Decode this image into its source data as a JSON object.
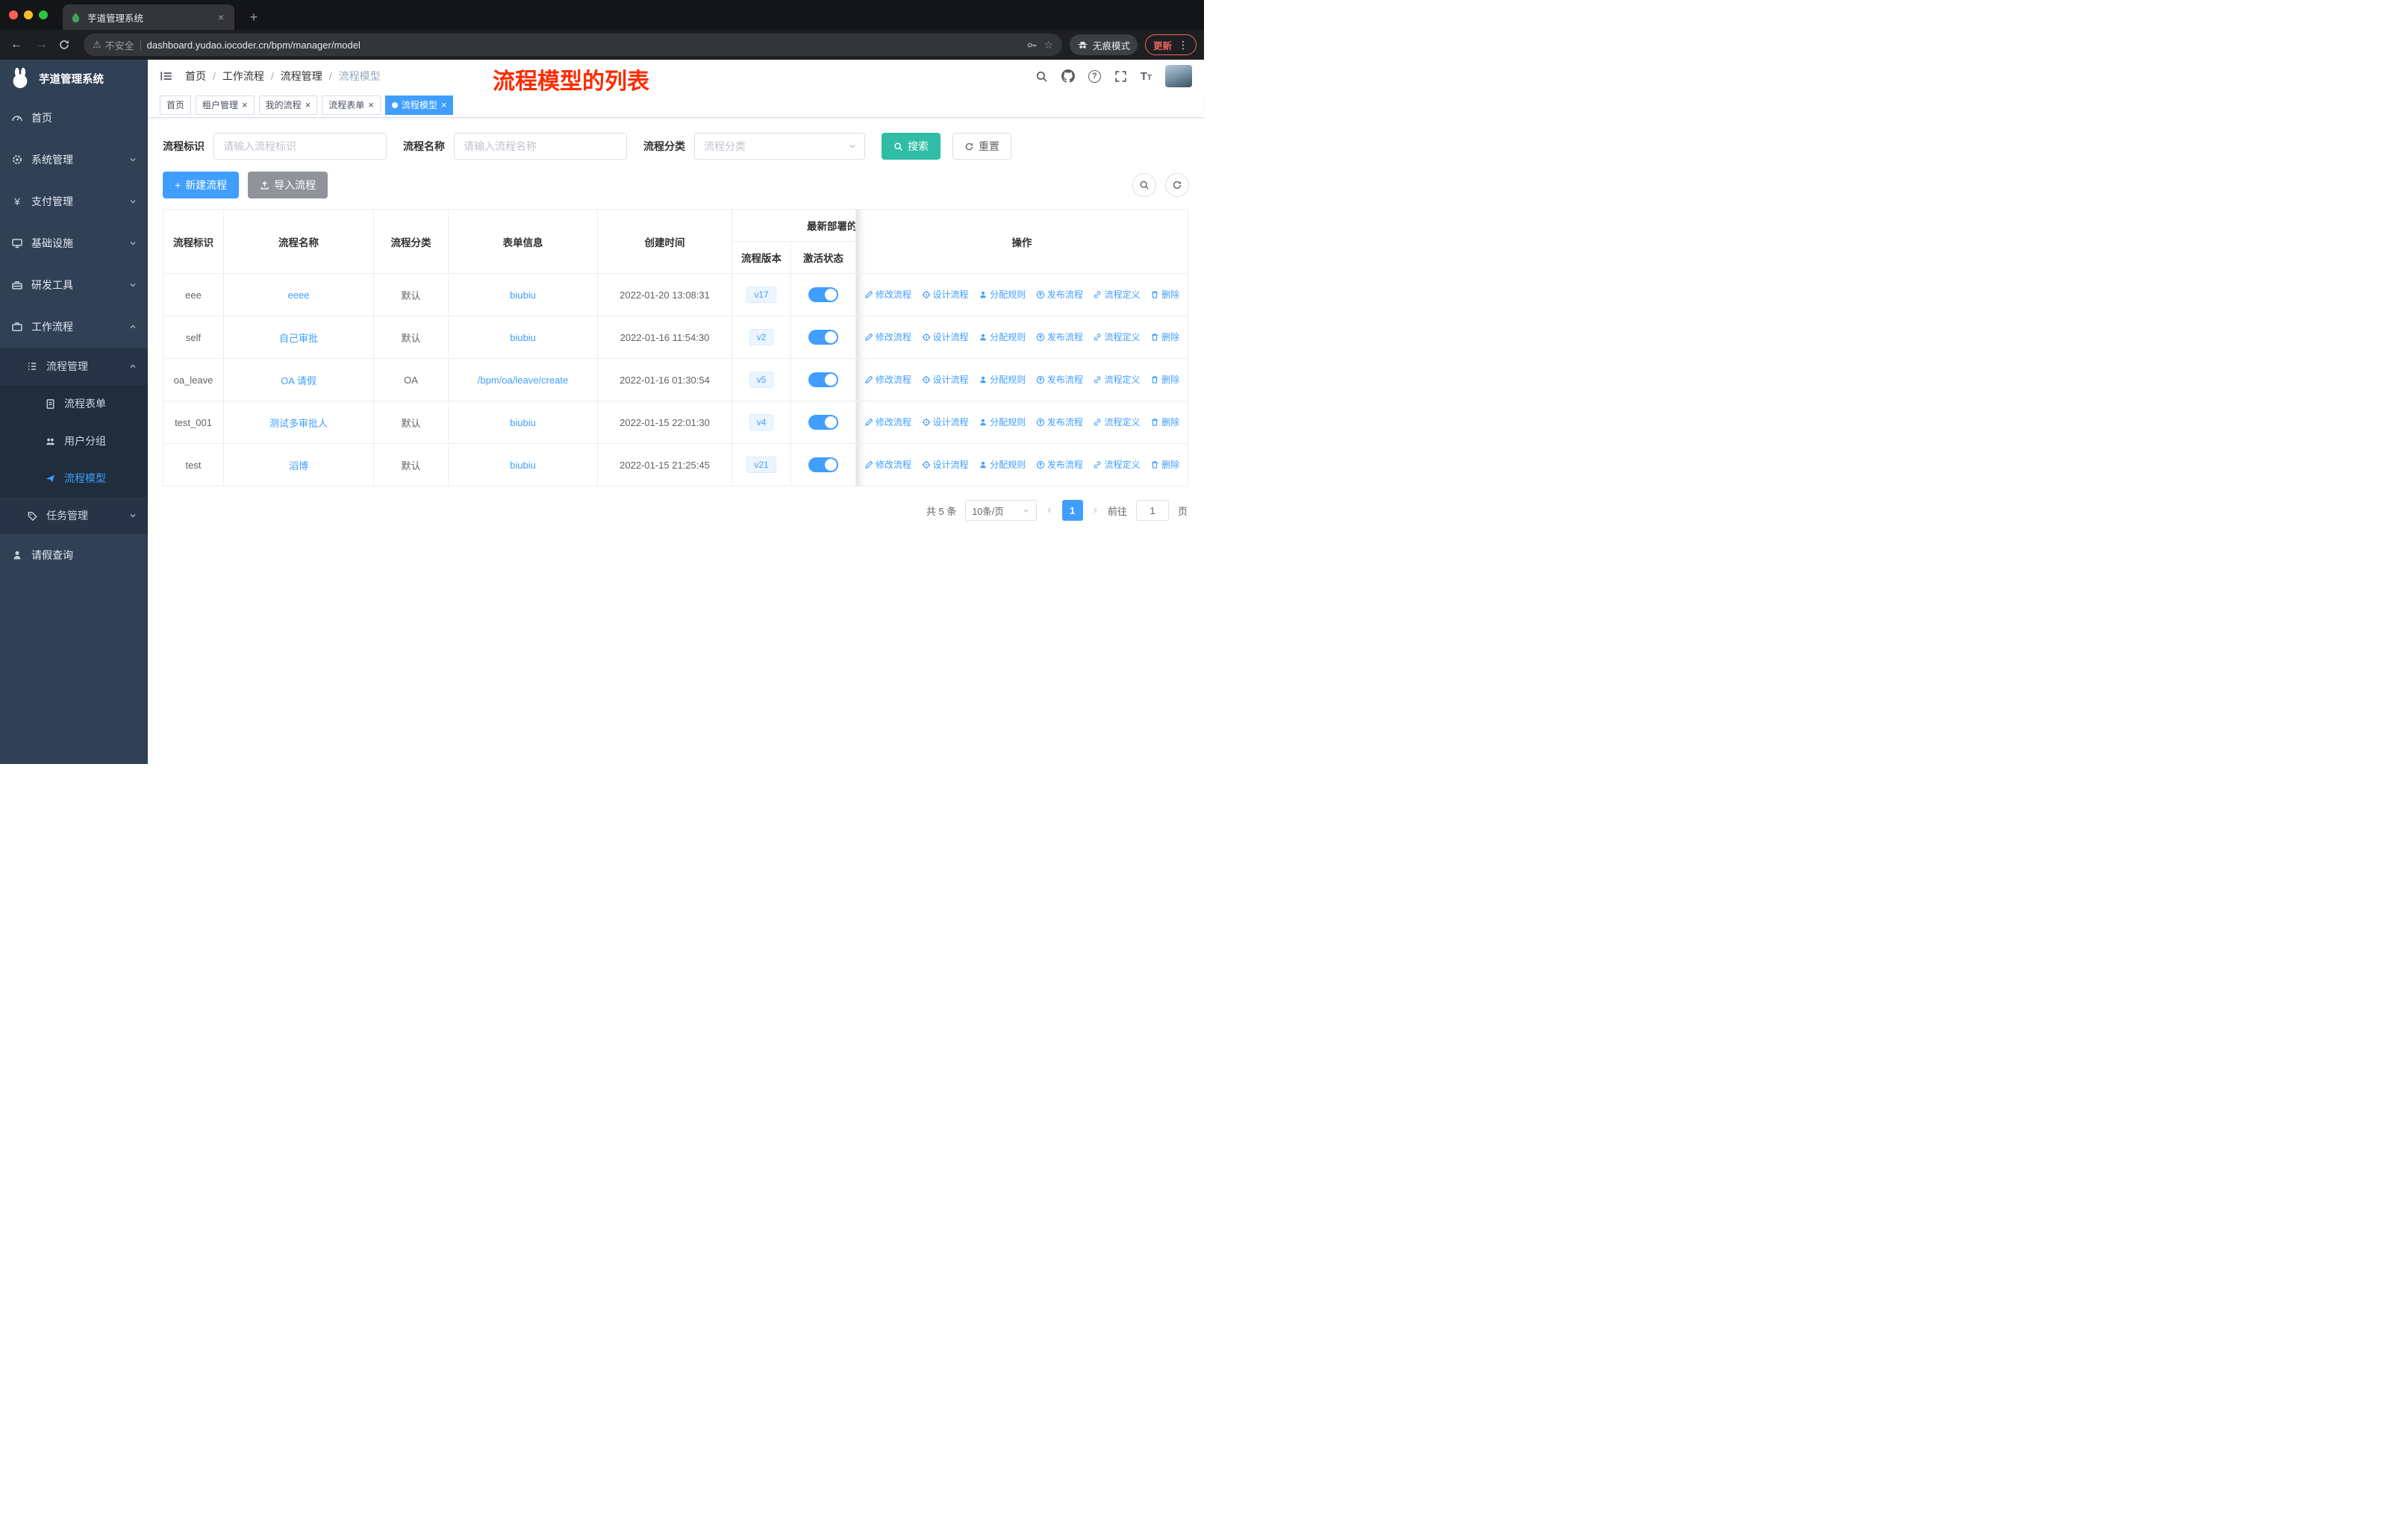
{
  "browser": {
    "tab_title": "芋道管理系统",
    "security_label": "不安全",
    "url": "dashboard.yudao.iocoder.cn/bpm/manager/model",
    "incognito_label": "无痕模式",
    "update_label": "更新"
  },
  "icons": {
    "back": "←",
    "forward": "→",
    "plus": "+",
    "close": "×",
    "more": "⋮",
    "warning": "⚠",
    "star": "☆",
    "yen": "¥",
    "question": "?",
    "prev": "‹",
    "next": "›",
    "font_big": "T",
    "font_small": "T"
  },
  "colors": {
    "accent": "#409EFF",
    "search_button": "#2FBDA6",
    "sidebar_bg": "#304156",
    "annotation": "#FF2B00",
    "toggle_on": "#409EFF",
    "tag_active": "#409EFF"
  },
  "sidebar": {
    "title": "芋道管理系统",
    "items": [
      {
        "label": "首页"
      },
      {
        "label": "系统管理"
      },
      {
        "label": "支付管理"
      },
      {
        "label": "基础设施"
      },
      {
        "label": "研发工具"
      },
      {
        "label": "工作流程"
      },
      {
        "label": "流程管理"
      },
      {
        "label": "流程表单"
      },
      {
        "label": "用户分组"
      },
      {
        "label": "流程模型"
      },
      {
        "label": "任务管理"
      },
      {
        "label": "请假查询"
      }
    ]
  },
  "header": {
    "breadcrumb": [
      "首页",
      "工作流程",
      "流程管理",
      "流程模型"
    ],
    "separator": "/",
    "annotation": "流程模型的列表"
  },
  "tags": [
    {
      "label": "首页"
    },
    {
      "label": "租户管理"
    },
    {
      "label": "我的流程"
    },
    {
      "label": "流程表单"
    },
    {
      "label": "流程模型"
    }
  ],
  "filters": {
    "id_label": "流程标识",
    "id_placeholder": "请输入流程标识",
    "name_label": "流程名称",
    "name_placeholder": "请输入流程名称",
    "category_label": "流程分类",
    "category_placeholder": "流程分类",
    "search_label": "搜索",
    "reset_label": "重置"
  },
  "toolbar": {
    "create_label": "新建流程",
    "import_label": "导入流程"
  },
  "table": {
    "headers": {
      "id": "流程标识",
      "name": "流程名称",
      "category": "流程分类",
      "form": "表单信息",
      "created": "创建时间",
      "deploy_group": "最新部署的",
      "version": "流程版本",
      "active": "激活状态",
      "actions": "操作"
    },
    "action_labels": [
      "修改流程",
      "设计流程",
      "分配规则",
      "发布流程",
      "流程定义",
      "删除"
    ],
    "rows": [
      {
        "id": "eee",
        "name": "eeee",
        "category": "默认",
        "form": "biubiu",
        "created": "2022-01-20 13:08:31",
        "version": "v17"
      },
      {
        "id": "self",
        "name": "自己审批",
        "category": "默认",
        "form": "biubiu",
        "created": "2022-01-16 11:54:30",
        "version": "v2"
      },
      {
        "id": "oa_leave",
        "name": "OA 请假",
        "category": "OA",
        "form": "/bpm/oa/leave/create",
        "created": "2022-01-16 01:30:54",
        "version": "v5"
      },
      {
        "id": "test_001",
        "name": "测试多审批人",
        "category": "默认",
        "form": "biubiu",
        "created": "2022-01-15 22:01:30",
        "version": "v4"
      },
      {
        "id": "test",
        "name": "滔博",
        "category": "默认",
        "form": "biubiu",
        "created": "2022-01-15 21:25:45",
        "version": "v21"
      }
    ]
  },
  "pagination": {
    "total_label": "共 5 条",
    "size_label": "10条/页",
    "page": "1",
    "page_input": "1",
    "goto_label": "前往",
    "page_unit": "页"
  }
}
